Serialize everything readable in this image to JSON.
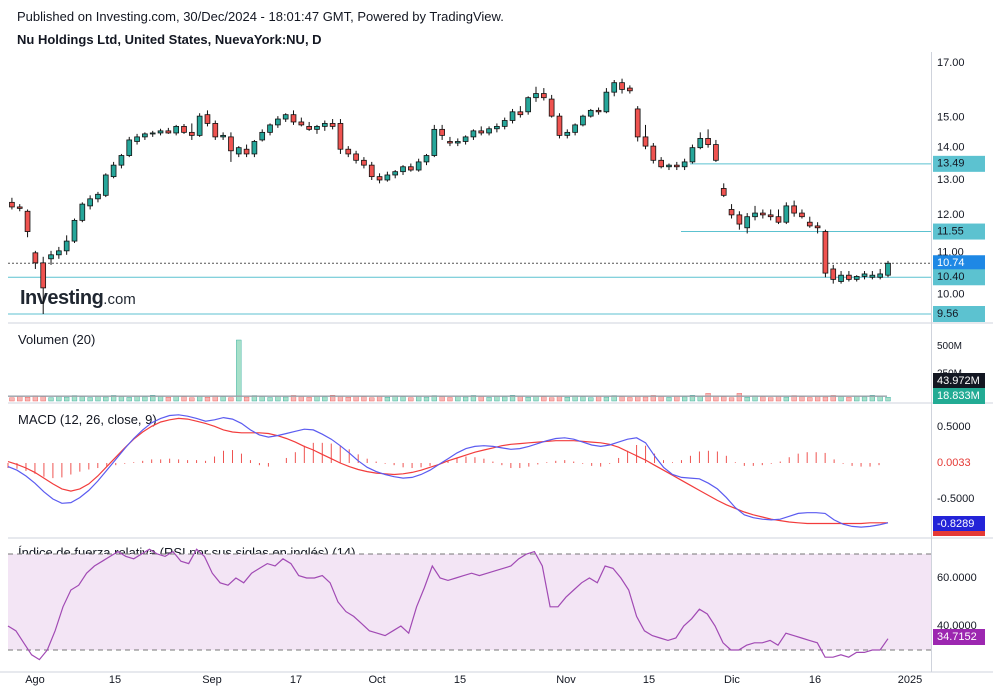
{
  "header": {
    "published": "Published on Investing.com, 30/Dec/2024 - 18:01:47 GMT, Powered by TradingView.",
    "symbol": "Nu Holdings Ltd, United States, NuevaYork:NU, D"
  },
  "logo": {
    "brand": "Investing",
    "suffix": ".com"
  },
  "colors": {
    "up": "#26a69a",
    "down": "#ef5350",
    "macd": "#5b5bf0",
    "signal": "#f23c3c",
    "rsi": "#a14ab4",
    "hline": "#5cc2d0"
  },
  "chart_data": [
    {
      "type": "candlestick",
      "title": "Nu Holdings Ltd, United States, NuevaYork:NU, D",
      "y_scale": "log",
      "y_ticks": [
        "17.00",
        "15.00",
        "14.00",
        "13.00",
        "12.00",
        "11.00",
        "10.00"
      ],
      "price_marks": [
        {
          "label": "13.49",
          "value": 13.49
        },
        {
          "label": "11.55",
          "value": 11.55
        },
        {
          "label": "10.74",
          "value": 10.74
        },
        {
          "label": "10.40",
          "value": 10.4
        },
        {
          "label": "9.56",
          "value": 9.56
        }
      ],
      "last_price": 10.74,
      "x_ticks": [
        "Ago",
        "15",
        "Sep",
        "17",
        "Oct",
        "15",
        "Nov",
        "15",
        "Dic",
        "16",
        "2025"
      ],
      "candles": [
        [
          12.35,
          12.48,
          12.15,
          12.22
        ],
        [
          12.22,
          12.3,
          12.1,
          12.18
        ],
        [
          12.1,
          12.15,
          11.4,
          11.55
        ],
        [
          11.0,
          11.05,
          10.6,
          10.75
        ],
        [
          10.75,
          10.9,
          9.56,
          10.15
        ],
        [
          10.85,
          11.05,
          10.7,
          10.95
        ],
        [
          10.95,
          11.15,
          10.85,
          11.05
        ],
        [
          11.05,
          11.45,
          10.95,
          11.3
        ],
        [
          11.3,
          11.9,
          11.25,
          11.85
        ],
        [
          11.85,
          12.35,
          11.8,
          12.3
        ],
        [
          12.25,
          12.55,
          12.15,
          12.45
        ],
        [
          12.45,
          12.65,
          12.35,
          12.58
        ],
        [
          12.55,
          13.2,
          12.5,
          13.15
        ],
        [
          13.1,
          13.55,
          13.05,
          13.45
        ],
        [
          13.45,
          13.8,
          13.35,
          13.75
        ],
        [
          13.75,
          14.35,
          13.7,
          14.25
        ],
        [
          14.2,
          14.45,
          14.1,
          14.35
        ],
        [
          14.35,
          14.5,
          14.25,
          14.45
        ],
        [
          14.45,
          14.55,
          14.35,
          14.48
        ],
        [
          14.48,
          14.62,
          14.4,
          14.55
        ],
        [
          14.55,
          14.65,
          14.45,
          14.48
        ],
        [
          14.48,
          14.75,
          14.4,
          14.7
        ],
        [
          14.7,
          14.78,
          14.45,
          14.5
        ],
        [
          14.5,
          14.8,
          14.25,
          14.4
        ],
        [
          14.4,
          15.15,
          14.35,
          15.05
        ],
        [
          15.1,
          15.25,
          14.7,
          14.8
        ],
        [
          14.8,
          14.9,
          14.25,
          14.35
        ],
        [
          14.35,
          14.5,
          14.25,
          14.4
        ],
        [
          14.35,
          14.5,
          13.55,
          13.9
        ],
        [
          13.8,
          14.05,
          13.7,
          14.0
        ],
        [
          13.95,
          14.1,
          13.7,
          13.8
        ],
        [
          13.8,
          14.25,
          13.7,
          14.2
        ],
        [
          14.25,
          14.6,
          14.2,
          14.5
        ],
        [
          14.5,
          14.8,
          14.4,
          14.75
        ],
        [
          14.75,
          15.05,
          14.65,
          14.95
        ],
        [
          14.95,
          15.15,
          14.85,
          15.1
        ],
        [
          15.1,
          15.25,
          14.75,
          14.85
        ],
        [
          14.85,
          15.0,
          14.7,
          14.75
        ],
        [
          14.7,
          14.85,
          14.55,
          14.6
        ],
        [
          14.6,
          14.75,
          14.45,
          14.7
        ],
        [
          14.7,
          14.9,
          14.55,
          14.8
        ],
        [
          14.8,
          14.95,
          14.6,
          14.7
        ],
        [
          14.8,
          14.95,
          13.8,
          13.95
        ],
        [
          13.95,
          14.05,
          13.7,
          13.8
        ],
        [
          13.8,
          13.9,
          13.5,
          13.6
        ],
        [
          13.6,
          13.7,
          13.35,
          13.45
        ],
        [
          13.45,
          13.55,
          13.0,
          13.1
        ],
        [
          13.1,
          13.2,
          12.9,
          13.0
        ],
        [
          13.0,
          13.25,
          12.95,
          13.15
        ],
        [
          13.15,
          13.3,
          13.05,
          13.25
        ],
        [
          13.25,
          13.45,
          13.15,
          13.4
        ],
        [
          13.4,
          13.5,
          13.25,
          13.3
        ],
        [
          13.3,
          13.65,
          13.25,
          13.55
        ],
        [
          13.55,
          13.8,
          13.45,
          13.75
        ],
        [
          13.75,
          14.75,
          13.7,
          14.6
        ],
        [
          14.6,
          14.75,
          14.25,
          14.4
        ],
        [
          14.2,
          14.35,
          14.05,
          14.15
        ],
        [
          14.15,
          14.3,
          14.05,
          14.2
        ],
        [
          14.2,
          14.4,
          14.1,
          14.35
        ],
        [
          14.35,
          14.6,
          14.25,
          14.55
        ],
        [
          14.55,
          14.7,
          14.4,
          14.48
        ],
        [
          14.48,
          14.7,
          14.4,
          14.62
        ],
        [
          14.62,
          14.8,
          14.5,
          14.7
        ],
        [
          14.7,
          15.0,
          14.6,
          14.9
        ],
        [
          14.9,
          15.3,
          14.8,
          15.2
        ],
        [
          15.2,
          15.4,
          15.0,
          15.1
        ],
        [
          15.2,
          15.75,
          15.1,
          15.7
        ],
        [
          15.7,
          16.1,
          15.55,
          15.85
        ],
        [
          15.85,
          16.05,
          15.6,
          15.7
        ],
        [
          15.65,
          15.8,
          15.0,
          15.05
        ],
        [
          15.05,
          15.15,
          14.3,
          14.4
        ],
        [
          14.4,
          14.6,
          14.3,
          14.5
        ],
        [
          14.5,
          14.8,
          14.4,
          14.75
        ],
        [
          14.75,
          15.1,
          14.7,
          15.05
        ],
        [
          15.05,
          15.3,
          15.0,
          15.25
        ],
        [
          15.25,
          15.35,
          15.1,
          15.2
        ],
        [
          15.2,
          16.05,
          15.15,
          15.9
        ],
        [
          15.9,
          16.35,
          15.75,
          16.25
        ],
        [
          16.25,
          16.4,
          15.85,
          16.0
        ],
        [
          16.05,
          16.15,
          15.85,
          15.95
        ],
        [
          15.3,
          15.4,
          14.2,
          14.35
        ],
        [
          14.35,
          14.75,
          13.95,
          14.05
        ],
        [
          14.05,
          14.15,
          13.5,
          13.6
        ],
        [
          13.6,
          13.7,
          13.35,
          13.4
        ],
        [
          13.4,
          13.5,
          13.3,
          13.45
        ],
        [
          13.45,
          13.55,
          13.3,
          13.4
        ],
        [
          13.4,
          13.65,
          13.3,
          13.55
        ],
        [
          13.55,
          14.1,
          13.5,
          14.0
        ],
        [
          14.0,
          14.5,
          13.95,
          14.3
        ],
        [
          14.3,
          14.6,
          14.0,
          14.1
        ],
        [
          14.1,
          14.25,
          13.55,
          13.6
        ],
        [
          12.75,
          12.9,
          12.5,
          12.55
        ],
        [
          12.15,
          12.3,
          11.9,
          12.0
        ],
        [
          12.0,
          12.1,
          11.6,
          11.75
        ],
        [
          11.65,
          12.05,
          11.5,
          11.95
        ],
        [
          11.95,
          12.25,
          11.85,
          12.05
        ],
        [
          12.05,
          12.15,
          11.9,
          12.0
        ],
        [
          12.0,
          12.15,
          11.85,
          11.95
        ],
        [
          11.95,
          12.15,
          11.75,
          11.8
        ],
        [
          11.8,
          12.35,
          11.75,
          12.25
        ],
        [
          12.25,
          12.4,
          11.95,
          12.05
        ],
        [
          12.05,
          12.15,
          11.9,
          11.95
        ],
        [
          11.8,
          11.95,
          11.65,
          11.7
        ],
        [
          11.7,
          11.8,
          11.5,
          11.65
        ],
        [
          11.55,
          11.6,
          10.4,
          10.5
        ],
        [
          10.6,
          10.7,
          10.25,
          10.35
        ],
        [
          10.3,
          10.55,
          10.25,
          10.45
        ],
        [
          10.45,
          10.55,
          10.3,
          10.35
        ],
        [
          10.35,
          10.45,
          10.3,
          10.42
        ],
        [
          10.42,
          10.55,
          10.35,
          10.48
        ],
        [
          10.4,
          10.55,
          10.35,
          10.45
        ],
        [
          10.4,
          10.6,
          10.35,
          10.48
        ],
        [
          10.45,
          10.8,
          10.4,
          10.74
        ]
      ]
    },
    {
      "type": "bar",
      "title": "Volumen (20)",
      "y_ticks": [
        "500M",
        "250M"
      ],
      "last_labels": [
        {
          "label": "43.972M",
          "value": 43.972
        },
        {
          "label": "18.833M",
          "value": 18.833
        }
      ],
      "spike": {
        "index": 29,
        "value": 560
      },
      "volume_ma_level": 43.972,
      "baseline_volume": 30
    },
    {
      "type": "line",
      "title": "MACD (12, 26, close, 9)",
      "y_ticks": [
        "0.5000",
        "-0.5000"
      ],
      "last_labels": [
        {
          "label": "0.0033",
          "value": 0.0033
        },
        {
          "label": "-0.8289",
          "value": -0.8289
        }
      ],
      "series": [
        {
          "name": "MACD",
          "values": [
            -0.05,
            -0.1,
            -0.18,
            -0.28,
            -0.4,
            -0.5,
            -0.56,
            -0.55,
            -0.48,
            -0.38,
            -0.25,
            -0.1,
            0.05,
            0.2,
            0.34,
            0.46,
            0.56,
            0.62,
            0.66,
            0.67,
            0.65,
            0.62,
            0.58,
            0.6,
            0.63,
            0.61,
            0.55,
            0.46,
            0.39,
            0.36,
            0.38,
            0.41,
            0.44,
            0.47,
            0.46,
            0.4,
            0.33,
            0.24,
            0.14,
            0.03,
            -0.06,
            -0.12,
            -0.16,
            -0.19,
            -0.21,
            -0.2,
            -0.16,
            -0.1,
            -0.02,
            0.06,
            0.14,
            0.2,
            0.23,
            0.24,
            0.23,
            0.21,
            0.19,
            0.2,
            0.23,
            0.27,
            0.31,
            0.34,
            0.35,
            0.33,
            0.29,
            0.25,
            0.23,
            0.25,
            0.29,
            0.33,
            0.35,
            0.28,
            0.1,
            -0.06,
            -0.16,
            -0.2,
            -0.21,
            -0.22,
            -0.28,
            -0.36,
            -0.48,
            -0.62,
            -0.72,
            -0.76,
            -0.78,
            -0.79,
            -0.78,
            -0.74,
            -0.7,
            -0.69,
            -0.69,
            -0.7,
            -0.79,
            -0.85,
            -0.88,
            -0.89,
            -0.88,
            -0.86,
            -0.83
          ]
        },
        {
          "name": "Signal",
          "values": [
            0.02,
            -0.02,
            -0.07,
            -0.13,
            -0.21,
            -0.29,
            -0.36,
            -0.39,
            -0.36,
            -0.29,
            -0.18,
            -0.05,
            0.08,
            0.21,
            0.33,
            0.43,
            0.51,
            0.57,
            0.6,
            0.62,
            0.61,
            0.58,
            0.55,
            0.51,
            0.46,
            0.43,
            0.42,
            0.42,
            0.42,
            0.41,
            0.38,
            0.34,
            0.29,
            0.23,
            0.18,
            0.12,
            0.06,
            0.0,
            -0.05,
            -0.09,
            -0.12,
            -0.14,
            -0.15,
            -0.16,
            -0.15,
            -0.13,
            -0.1,
            -0.06,
            -0.02,
            0.03,
            0.07,
            0.11,
            0.15,
            0.18,
            0.21,
            0.24,
            0.26,
            0.27,
            0.28,
            0.29,
            0.3,
            0.31,
            0.31,
            0.31,
            0.3,
            0.29,
            0.28,
            0.26,
            0.22,
            0.16,
            0.1,
            0.04,
            -0.03,
            -0.1,
            -0.17,
            -0.24,
            -0.31,
            -0.38,
            -0.45,
            -0.52,
            -0.58,
            -0.63,
            -0.68,
            -0.72,
            -0.75,
            -0.78,
            -0.8,
            -0.82,
            -0.83,
            -0.84,
            -0.84,
            -0.84,
            -0.84,
            -0.84,
            -0.84,
            -0.84,
            -0.83,
            -0.83,
            -0.83
          ]
        }
      ]
    },
    {
      "type": "line",
      "title": "Índice de fuerza relativa (RSI por sus siglas en inglés) (14)",
      "y_ticks": [
        "60.0000",
        "40.0000"
      ],
      "bands": [
        70,
        30
      ],
      "last_labels": [
        {
          "label": "34.7152",
          "value": 34.7152
        }
      ],
      "series": [
        {
          "name": "RSI",
          "values": [
            40,
            38,
            33,
            28,
            26,
            30,
            38,
            48,
            55,
            57,
            62,
            65,
            67,
            69,
            71,
            69,
            68,
            70,
            72,
            70,
            69,
            71,
            67,
            66,
            72,
            69,
            62,
            58,
            57,
            60,
            58,
            62,
            64,
            66,
            65,
            68,
            66,
            61,
            60,
            60,
            61,
            58,
            50,
            46,
            44,
            41,
            38,
            37,
            36,
            38,
            40,
            37,
            48,
            56,
            65,
            60,
            59,
            60,
            61,
            62,
            61,
            62,
            63,
            64,
            65,
            68,
            70,
            71,
            65,
            48,
            48,
            52,
            55,
            58,
            60,
            58,
            65,
            64,
            60,
            55,
            44,
            38,
            36,
            35,
            34,
            35,
            40,
            43,
            47,
            45,
            40,
            33,
            30,
            30,
            32,
            33,
            33,
            34,
            32,
            37,
            36,
            35,
            34,
            33,
            27,
            27,
            28,
            27,
            29,
            29,
            30,
            30,
            34.7
          ]
        }
      ]
    }
  ]
}
